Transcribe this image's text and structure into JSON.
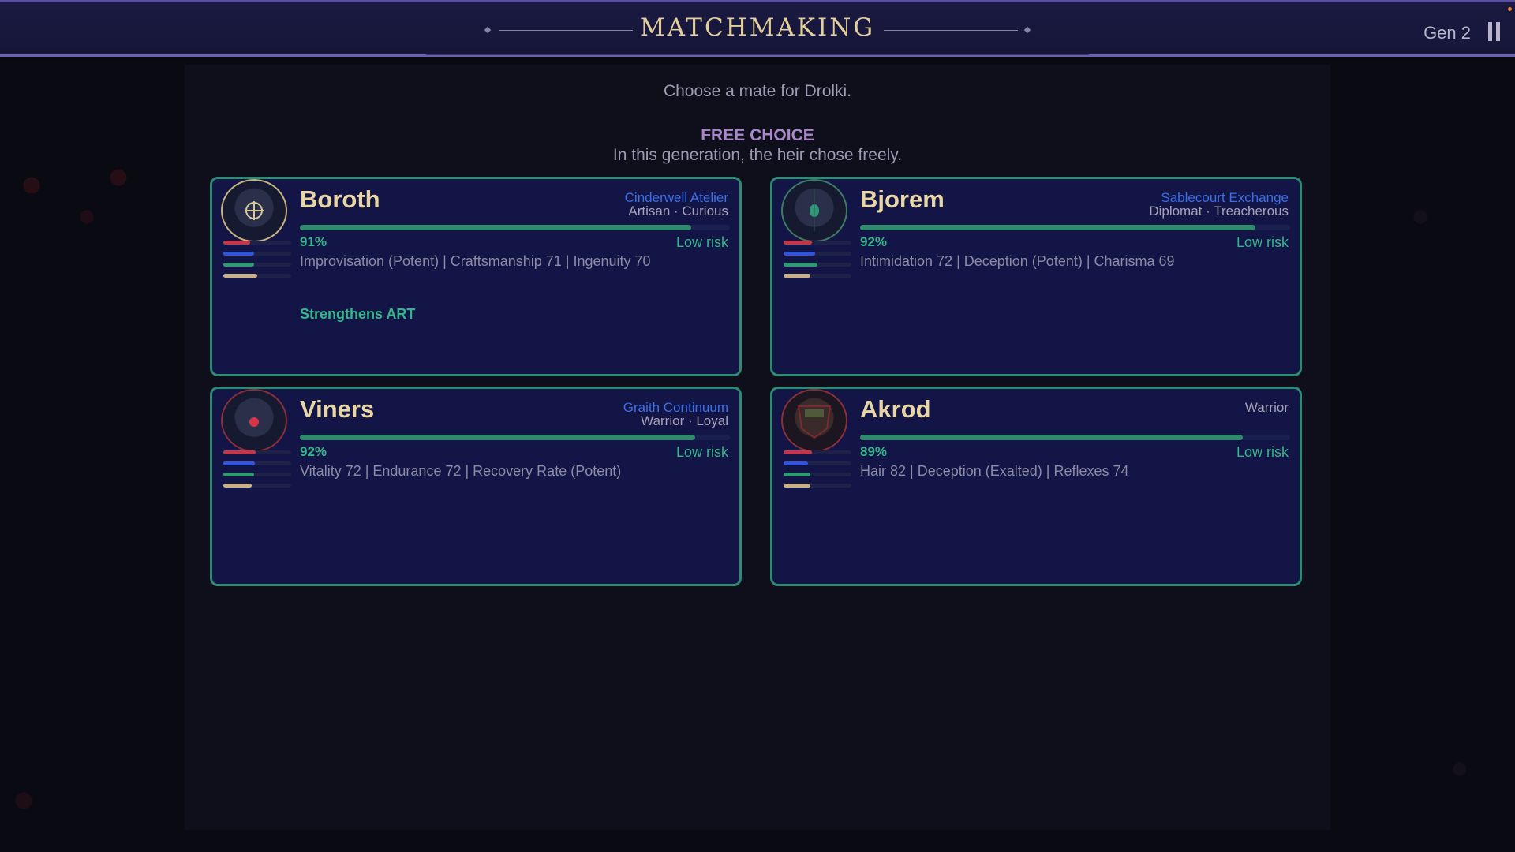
{
  "header": {
    "title": "MATCHMAKING",
    "generation": "Gen 2"
  },
  "prompt": "Choose a mate for Drolki.",
  "choice": {
    "title": "FREE CHOICE",
    "subtitle": "In this generation, the heir chose freely."
  },
  "colors": {
    "card_border": "#2e8a72",
    "faction": "#3b6fe6",
    "positive": "#34b58a",
    "title": "#e2cf9d"
  },
  "candidates": [
    {
      "name": "Boroth",
      "faction": "Cinderwell Atelier",
      "traits": "Artisan · Curious",
      "compatibility": "91%",
      "compatibility_fraction": 0.91,
      "risk": "Low risk",
      "skills": "Improvisation (Potent)  |  Craftsmanship 71  |  Ingenuity 70",
      "bonus": "Strengthens ART",
      "portrait_icon": "crosshair-emblem-icon",
      "stat_levels": [
        0.4,
        0.45,
        0.45,
        0.5
      ]
    },
    {
      "name": "Bjorem",
      "faction": "Sablecourt Exchange",
      "traits": "Diplomat · Treacherous",
      "compatibility": "92%",
      "compatibility_fraction": 0.92,
      "risk": "Low risk",
      "skills": "Intimidation 72  |  Deception (Potent)  |  Charisma 69",
      "bonus": "",
      "portrait_icon": "green-gem-emblem-icon",
      "stat_levels": [
        0.42,
        0.46,
        0.5,
        0.4
      ]
    },
    {
      "name": "Viners",
      "faction": "Graith Continuum",
      "traits": "Warrior · Loyal",
      "compatibility": "92%",
      "compatibility_fraction": 0.92,
      "risk": "Low risk",
      "skills": "Vitality 72  |  Endurance 72  |  Recovery Rate (Potent)",
      "bonus": "",
      "portrait_icon": "red-gem-emblem-icon",
      "stat_levels": [
        0.48,
        0.46,
        0.45,
        0.42
      ]
    },
    {
      "name": "Akrod",
      "faction": "",
      "traits": "Warrior",
      "compatibility": "89%",
      "compatibility_fraction": 0.89,
      "risk": "Low risk",
      "skills": "Hair 82  |  Deception (Exalted)  |  Reflexes 74",
      "bonus": "",
      "portrait_icon": "red-shield-emblem-icon",
      "stat_levels": [
        0.42,
        0.36,
        0.4,
        0.4
      ]
    }
  ]
}
